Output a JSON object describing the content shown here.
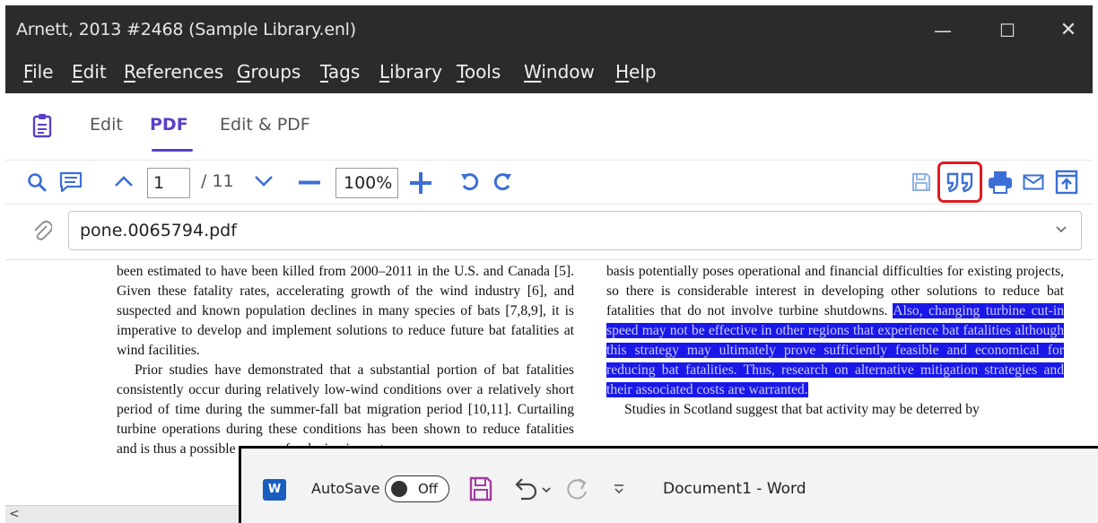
{
  "window": {
    "title": "Arnett, 2013 #2468 (Sample Library.enl)",
    "controls": {
      "minimize": "—",
      "maximize": "☐",
      "close": "✕"
    }
  },
  "menu": [
    {
      "underline": "F",
      "rest": "ile"
    },
    {
      "underline": "E",
      "rest": "dit"
    },
    {
      "underline": "R",
      "rest": "eferences"
    },
    {
      "underline": "G",
      "rest": "roups"
    },
    {
      "underline": "T",
      "rest": "ags"
    },
    {
      "underline": "L",
      "rest": "ibrary"
    },
    {
      "underline": "T",
      "rest": "ools"
    },
    {
      "underline": "W",
      "rest": "indow"
    },
    {
      "underline": "H",
      "rest": "elp"
    }
  ],
  "tabs": {
    "edit": "Edit",
    "pdf": "PDF",
    "edit_pdf": "Edit & PDF",
    "active": "PDF"
  },
  "toolbar": {
    "page_value": "1",
    "page_total": "/ 11",
    "zoom_value": "100%"
  },
  "file": {
    "name": "pone.0065794.pdf"
  },
  "pdf": {
    "left_p1": "been estimated to have been killed from 2000–2011 in the U.S. and Canada [5]. Given these fatality rates, accelerating growth of the wind industry [6], and suspected and known population declines in many species of bats [7,8,9], it is imperative to develop and implement solutions to reduce future bat fatalities at wind facilities.",
    "left_p2": "Prior studies have demonstrated that a substantial portion of bat fatalities consistently occur during relatively low-wind conditions over a relatively short period of time during the summer-fall bat migration period [10,11]. Curtailing turbine operations during these conditions has been shown to reduce fatalities and is thus a possible means of reducing impacts.",
    "right_p1_plain": "basis potentially poses operational and financial difficulties for existing projects, so there is considerable interest in developing other solutions to reduce bat fatalities that do not involve turbine shutdowns. ",
    "right_p1_highlight": "Also, changing turbine cut-in speed may not be effective in other regions that experience bat fatalities although this strategy may ultimately prove sufficiently feasible and economical for reducing bat fatalities. Thus, research on alternative mitigation strategies and their associated costs are warranted.",
    "right_p2": "Studies in Scotland suggest that bat activity may be deterred by"
  },
  "word": {
    "autosave_label": "AutoSave",
    "toggle_label": "Off",
    "doc_title": "Document1  -  Word",
    "logo_letter": "W"
  },
  "colors": {
    "accent": "#5b3fc6",
    "toolbar_icon": "#3b6fd6",
    "cite_highlight": "#e01a22",
    "pdf_highlight": "#1a18e8",
    "save_icon": "#a43aa0"
  }
}
